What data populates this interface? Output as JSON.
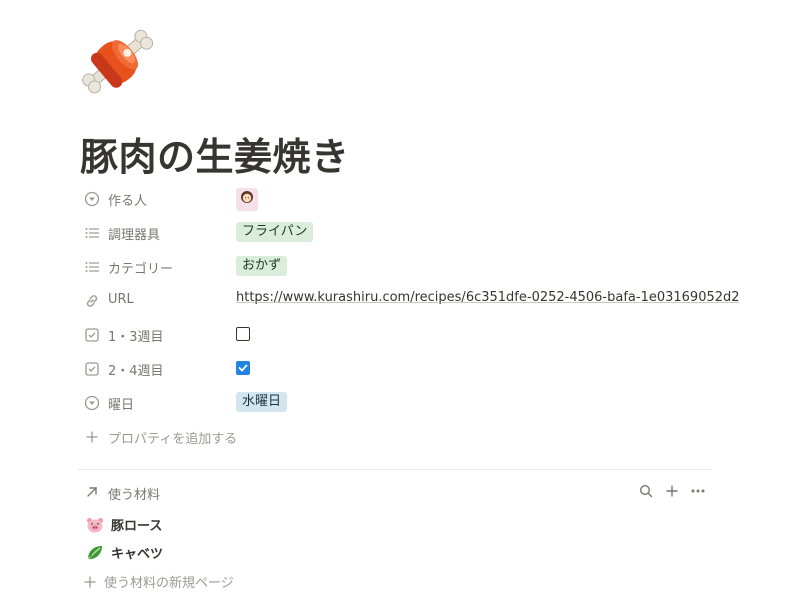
{
  "page": {
    "icon": "meat-on-bone-icon",
    "title": "豚肉の生姜焼き"
  },
  "properties": [
    {
      "icon": "select-icon",
      "label": "作る人",
      "type": "person",
      "value": "woman-emoji"
    },
    {
      "icon": "list-icon",
      "label": "調理器具",
      "type": "tag",
      "value": "フライパン",
      "color": "#dbeddb"
    },
    {
      "icon": "list-icon",
      "label": "カテゴリー",
      "type": "tag",
      "value": "おかず",
      "color": "#dbeddb"
    },
    {
      "icon": "link-icon",
      "label": "URL",
      "type": "url",
      "value": "https://www.kurashiru.com/recipes/6c351dfe-0252-4506-bafa-1e03169052d2"
    },
    {
      "icon": "checkbox-icon",
      "label": "1・3週目",
      "type": "checkbox",
      "checked": false
    },
    {
      "icon": "checkbox-icon",
      "label": "2・4週目",
      "type": "checkbox",
      "checked": true
    },
    {
      "icon": "select-icon",
      "label": "曜日",
      "type": "tag",
      "value": "水曜日",
      "color": "#d3e5ef"
    }
  ],
  "add_property_label": "プロパティを追加する",
  "relation": {
    "title": "使う材料",
    "items": [
      {
        "emoji": "pig-face-icon",
        "label": "豚ロース"
      },
      {
        "emoji": "leafy-green-icon",
        "label": "キャベツ"
      }
    ],
    "new_page_label": "使う材料の新規ページ"
  },
  "colors": {
    "accent_blue": "#2383e2",
    "tag_green": "#dbeddb",
    "tag_blue": "#d3e5ef",
    "muted_text": "#787774"
  }
}
